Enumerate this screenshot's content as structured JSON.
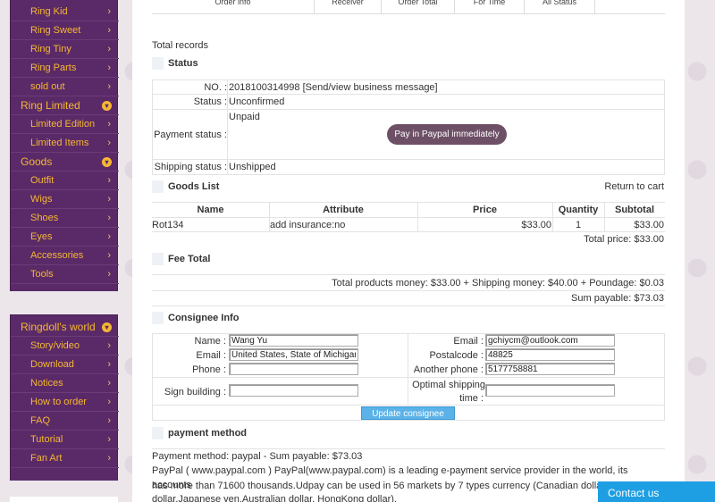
{
  "sidebar": {
    "group1": [
      {
        "label": "Ring Kid",
        "type": "sub"
      },
      {
        "label": "Ring Sweet",
        "type": "sub"
      },
      {
        "label": "Ring Tiny",
        "type": "sub"
      },
      {
        "label": "Ring Parts",
        "type": "sub"
      },
      {
        "label": "sold out",
        "type": "sub"
      },
      {
        "label": "Ring Limited",
        "type": "head"
      },
      {
        "label": "Limited Edition",
        "type": "sub"
      },
      {
        "label": "Limited Items",
        "type": "sub"
      },
      {
        "label": "Goods",
        "type": "head"
      },
      {
        "label": "Outfit",
        "type": "sub"
      },
      {
        "label": "Wigs",
        "type": "sub"
      },
      {
        "label": "Shoes",
        "type": "sub"
      },
      {
        "label": "Eyes",
        "type": "sub"
      },
      {
        "label": "Accessories",
        "type": "sub"
      },
      {
        "label": "Tools",
        "type": "sub"
      }
    ],
    "group2": [
      {
        "label": "Ringdoll's world",
        "type": "head"
      },
      {
        "label": "Story/video",
        "type": "sub"
      },
      {
        "label": "Download",
        "type": "sub"
      },
      {
        "label": "Notices",
        "type": "sub"
      },
      {
        "label": "How to order",
        "type": "sub"
      },
      {
        "label": "FAQ",
        "type": "sub"
      },
      {
        "label": "Tutorial",
        "type": "sub"
      },
      {
        "label": "Fan Art",
        "type": "sub"
      }
    ],
    "chevron": "›"
  },
  "top_stub": [
    "Order info",
    "Receiver",
    "Order Total",
    "For Time",
    "All Status"
  ],
  "total_records": "Total records",
  "status": {
    "heading": "Status",
    "no_label": "NO. :",
    "no_value": "2018100314998 [Send/view business message]",
    "status_label": "Status :",
    "status_value": "Unconfirmed",
    "payment_label": "Payment status :",
    "payment_value": "Unpaid",
    "pay_button": "Pay in Paypal immediately",
    "shipping_label": "Shipping status :",
    "shipping_value": "Unshipped"
  },
  "goods": {
    "heading": "Goods List",
    "return_link": "Return to cart",
    "columns": [
      "Name",
      "Attribute",
      "Price",
      "Quantity",
      "Subtotal"
    ],
    "row": {
      "name": "Rot134",
      "attribute": "add insurance:no",
      "price": "$33.00",
      "quantity": "1",
      "subtotal": "$33.00"
    },
    "total_price": "Total price: $33.00"
  },
  "fee": {
    "heading": "Fee Total",
    "line": "Total products money: $33.00 + Shipping money: $40.00 + Poundage: $0.03",
    "sum": "Sum payable: $73.03"
  },
  "consignee": {
    "heading": "Consignee Info",
    "name_label": "Name :",
    "name_value": "Wang Yu",
    "email_label": "Email :",
    "email_value": "gchiycm@outlook.com",
    "email2_label": "Email :",
    "address_value": "United States, State of Michigan",
    "postal_label": "Postalcode :",
    "postal_value": "48825",
    "phone_label": "Phone :",
    "phone_value": "",
    "another_phone_label": "Another phone :",
    "another_phone_value": "5177758881",
    "sign_label": "Sign building :",
    "sign_value": "",
    "optimal_label_1": "Optimal shipping",
    "optimal_label_2": "time :",
    "optimal_value": "",
    "update_button": "Update consignee addr"
  },
  "payment": {
    "heading": "payment method",
    "line1": "Payment method: paypal - Sum payable: $73.03",
    "line2": "PayPal ( www.paypal.com ) PayPal(www.paypal.com) is a leading e-payment service provider in the world, its accounts",
    "line3": "has more than 71600 thousands.Udpay can be used in 56 markets by 7 types currency (Canadian dollar,EU",
    "line4": "dollar,Japanese yen,Australian dollar, HongKong dollar)."
  },
  "contact_us": "Contact us"
}
